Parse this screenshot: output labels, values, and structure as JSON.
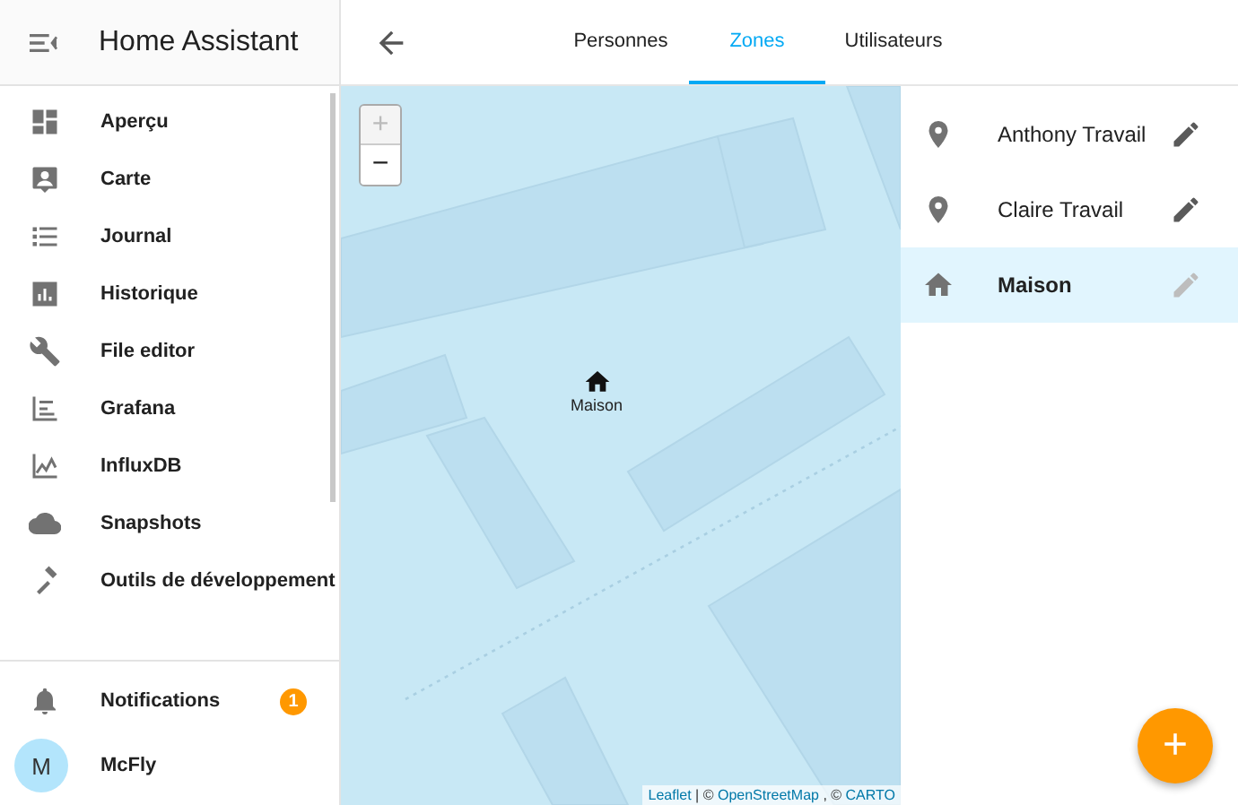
{
  "sidebar": {
    "title": "Home Assistant",
    "items": [
      {
        "label": "Aperçu"
      },
      {
        "label": "Carte"
      },
      {
        "label": "Journal"
      },
      {
        "label": "Historique"
      },
      {
        "label": "File editor"
      },
      {
        "label": "Grafana"
      },
      {
        "label": "InfluxDB"
      },
      {
        "label": "Snapshots"
      },
      {
        "label": "Outils de développement"
      }
    ],
    "notifications": {
      "label": "Notifications",
      "count": "1"
    },
    "user": {
      "initial": "M",
      "name": "McFly"
    }
  },
  "tabs": [
    {
      "label": "Personnes",
      "selected": false
    },
    {
      "label": "Zones",
      "selected": true
    },
    {
      "label": "Utilisateurs",
      "selected": false
    }
  ],
  "map": {
    "zoom_in": "+",
    "zoom_out": "−",
    "markers": [
      {
        "label": "Maison"
      }
    ],
    "attribution": [
      {
        "text": "Leaflet",
        "kind": "link"
      },
      {
        "text": "| ©",
        "kind": "text"
      },
      {
        "text": "OpenStreetMap",
        "kind": "link"
      },
      {
        "text": ", ©",
        "kind": "text"
      },
      {
        "text": "CARTO",
        "kind": "link"
      }
    ]
  },
  "zones": [
    {
      "name": "Anthony Travail",
      "kind": "zone",
      "selected": false,
      "disabled": false
    },
    {
      "name": "Claire Travail",
      "kind": "zone",
      "selected": false,
      "disabled": false
    },
    {
      "name": "Maison",
      "kind": "home",
      "selected": true,
      "disabled": true
    }
  ],
  "fab": "+"
}
